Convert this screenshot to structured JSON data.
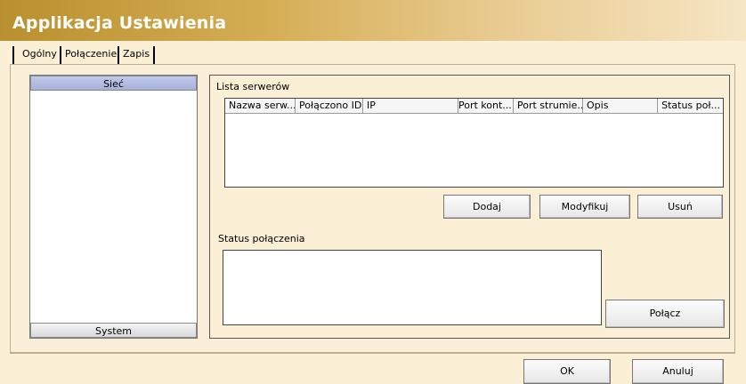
{
  "window": {
    "title": "Applikacja Ustawienia"
  },
  "tabs": [
    {
      "label": "Ogólny",
      "active": true
    },
    {
      "label": "Połączenie",
      "active": false
    },
    {
      "label": "Zapis",
      "active": false
    }
  ],
  "sidebar": {
    "top_label": "Sieć",
    "bottom_label": "System"
  },
  "server_list": {
    "label": "Lista serwerów",
    "columns": [
      "Nazwa serw...",
      "Połączono ID",
      "IP",
      "Port kont...",
      "Port strumie...",
      "Opis",
      "Status poł..."
    ],
    "rows": [],
    "buttons": {
      "add": "Dodaj",
      "modify": "Modyfikuj",
      "delete": "Usuń"
    }
  },
  "connection_status": {
    "label": "Status połączenia",
    "value": "",
    "connect_button": "Połącz"
  },
  "footer": {
    "ok": "OK",
    "cancel": "Anuluj"
  },
  "colors": {
    "title_gradient_start": "#b9902f",
    "title_gradient_end": "#f6e6c4",
    "background": "#fbefd6",
    "sidebar_header": "#b4bde1"
  }
}
